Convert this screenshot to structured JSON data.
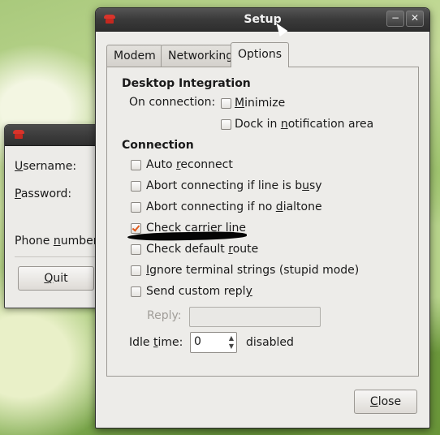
{
  "background_window": {
    "username_label": "Username:",
    "password_label": "Password:",
    "phone_label": "Phone number:",
    "quit_label": "Quit"
  },
  "dialog": {
    "title": "Setup",
    "tabs": [
      {
        "label": "Modem",
        "active": false
      },
      {
        "label": "Networking",
        "active": false
      },
      {
        "label": "Options",
        "active": true
      }
    ],
    "desktop_integration": {
      "heading": "Desktop Integration",
      "on_connection_label": "On connection:",
      "minimize": {
        "label": "Minimize",
        "checked": false
      },
      "dock": {
        "label": "Dock in notification area",
        "checked": false
      }
    },
    "connection": {
      "heading": "Connection",
      "options": [
        {
          "label": "Auto reconnect",
          "checked": false
        },
        {
          "label": "Abort connecting if line is busy",
          "checked": false
        },
        {
          "label": "Abort connecting if no dialtone",
          "checked": false
        },
        {
          "label": "Check carrier line",
          "checked": true
        },
        {
          "label": "Check default route",
          "checked": false
        },
        {
          "label": "Ignore terminal strings (stupid mode)",
          "checked": false
        },
        {
          "label": "Send custom reply",
          "checked": false
        }
      ],
      "reply_label": "Reply:",
      "reply_value": "",
      "idle_label": "Idle time:",
      "idle_value": "0",
      "idle_suffix": "disabled"
    },
    "close_label": "Close"
  },
  "colors": {
    "check_mark": "#e05a1c",
    "titlebar": "#3a3a3a"
  }
}
